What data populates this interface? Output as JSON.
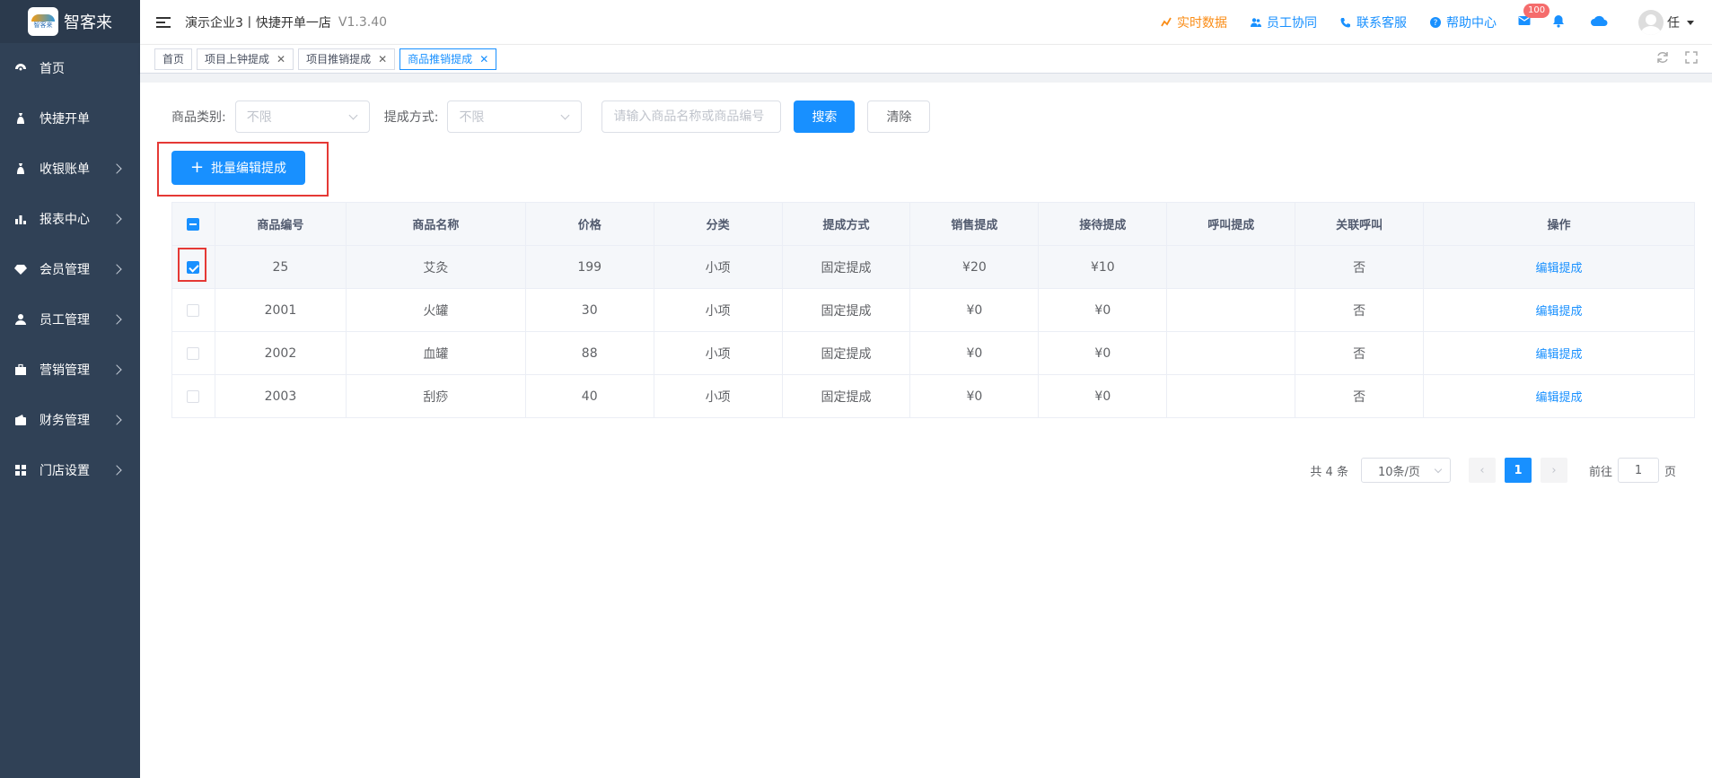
{
  "sidebar": {
    "logo_text": "智客来",
    "logo_mini": "智客来",
    "items": [
      {
        "label": "首页"
      },
      {
        "label": "快捷开单"
      },
      {
        "label": "收银账单"
      },
      {
        "label": "报表中心"
      },
      {
        "label": "会员管理"
      },
      {
        "label": "员工管理"
      },
      {
        "label": "营销管理"
      },
      {
        "label": "财务管理"
      },
      {
        "label": "门店设置"
      }
    ]
  },
  "header": {
    "company": "演示企业3丨快捷开单一店",
    "version": "V1.3.40",
    "links": {
      "realtime": "实时数据",
      "staff": "员工协同",
      "service": "联系客服",
      "help": "帮助中心"
    },
    "mail_badge": "100",
    "user": "任"
  },
  "tabs": [
    {
      "label": "首页"
    },
    {
      "label": "项目上钟提成"
    },
    {
      "label": "项目推销提成"
    },
    {
      "label": "商品推销提成"
    }
  ],
  "filters": {
    "category_label": "商品类别:",
    "category_value": "不限",
    "method_label": "提成方式:",
    "method_value": "不限",
    "search_placeholder": "请输入商品名称或商品编号",
    "search_btn": "搜索",
    "clear_btn": "清除"
  },
  "batch_btn": "批量编辑提成",
  "table": {
    "headers": [
      "商品编号",
      "商品名称",
      "价格",
      "分类",
      "提成方式",
      "销售提成",
      "接待提成",
      "呼叫提成",
      "关联呼叫",
      "操作"
    ],
    "rows": [
      {
        "id": "25",
        "name": "艾灸",
        "price": "199",
        "cat": "小项",
        "method": "固定提成",
        "sale": "¥20",
        "recv": "¥10",
        "call": "",
        "linked": "否",
        "action": "编辑提成"
      },
      {
        "id": "2001",
        "name": "火罐",
        "price": "30",
        "cat": "小项",
        "method": "固定提成",
        "sale": "¥0",
        "recv": "¥0",
        "call": "",
        "linked": "否",
        "action": "编辑提成"
      },
      {
        "id": "2002",
        "name": "血罐",
        "price": "88",
        "cat": "小项",
        "method": "固定提成",
        "sale": "¥0",
        "recv": "¥0",
        "call": "",
        "linked": "否",
        "action": "编辑提成"
      },
      {
        "id": "2003",
        "name": "刮痧",
        "price": "40",
        "cat": "小项",
        "method": "固定提成",
        "sale": "¥0",
        "recv": "¥0",
        "call": "",
        "linked": "否",
        "action": "编辑提成"
      }
    ]
  },
  "pagination": {
    "total": "共 4 条",
    "page_size": "10条/页",
    "current": "1",
    "goto_prefix": "前往",
    "goto_value": "1",
    "goto_suffix": "页"
  },
  "colors": {
    "primary": "#1890ff",
    "sidebar": "#304156",
    "highlight": "#e53935"
  }
}
